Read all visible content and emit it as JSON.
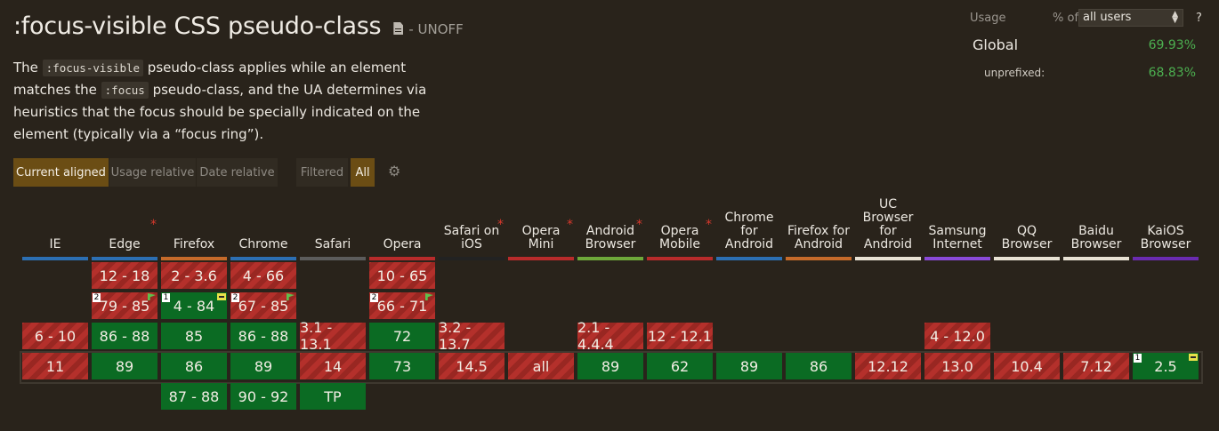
{
  "title": ":focus-visible CSS pseudo-class",
  "status": "- UNOFF",
  "description": {
    "p1": "The ",
    "code1": ":focus-visible",
    "p2": " pseudo-class applies while an element matches the ",
    "code2": ":focus",
    "p3": " pseudo-class, and the UA determines via heuristics that the focus should be specially indicated on the element (typically via a “focus ring”)."
  },
  "view_buttons": [
    "Current aligned",
    "Usage relative",
    "Date relative"
  ],
  "filter_buttons": [
    "Filtered",
    "All"
  ],
  "usage": {
    "label": "Usage",
    "pct_of": "% of",
    "selected": "all users",
    "help": "?",
    "global_label": "Global",
    "global_value": "69.93%",
    "unprefixed_label": "unprefixed:",
    "unprefixed_value": "68.83%"
  },
  "colors": {
    "supported": "#0b6b23",
    "unsupported": "#b4302b",
    "background": "#29231b",
    "active_button": "#6b4d14"
  },
  "browsers": [
    {
      "name": "IE",
      "star": false,
      "color": "#2c6fb3"
    },
    {
      "name": "Edge",
      "star": true,
      "color": "#2c6fb3"
    },
    {
      "name": "Firefox",
      "star": false,
      "color": "#c56a2a"
    },
    {
      "name": "Chrome",
      "star": false,
      "color": "#2c6fb3"
    },
    {
      "name": "Safari",
      "star": false,
      "color": "#5c5c5c"
    },
    {
      "name": "Opera",
      "star": false,
      "color": "#b82b2b"
    },
    {
      "name": "Safari on iOS",
      "star": true,
      "color": "#222222"
    },
    {
      "name": "Opera Mini",
      "star": true,
      "color": "#b82b2b"
    },
    {
      "name": "Android Browser",
      "star": true,
      "color": "#6ea83a"
    },
    {
      "name": "Opera Mobile",
      "star": true,
      "color": "#b82b2b"
    },
    {
      "name": "Chrome for Android",
      "star": false,
      "color": "#2c6fb3"
    },
    {
      "name": "Firefox for Android",
      "star": false,
      "color": "#c56a2a"
    },
    {
      "name": "UC Browser for Android",
      "star": false,
      "color": "#e8e2d4"
    },
    {
      "name": "Samsung Internet",
      "star": false,
      "color": "#8a4ad8"
    },
    {
      "name": "QQ Browser",
      "star": false,
      "color": "#e8e2d4"
    },
    {
      "name": "Baidu Browser",
      "star": false,
      "color": "#e8e2d4"
    },
    {
      "name": "KaiOS Browser",
      "star": false,
      "color": "#6a2bb0"
    }
  ],
  "cells": [
    {
      "col": 1,
      "row": 0,
      "text": "12 - 18",
      "s": "n"
    },
    {
      "col": 2,
      "row": 0,
      "text": "2 - 3.6",
      "s": "n"
    },
    {
      "col": 3,
      "row": 0,
      "text": "4 - 66",
      "s": "n"
    },
    {
      "col": 5,
      "row": 0,
      "text": "10 - 65",
      "s": "n"
    },
    {
      "col": 1,
      "row": 1,
      "text": "79 - 85",
      "s": "n",
      "note": "2",
      "mark": "flag"
    },
    {
      "col": 2,
      "row": 1,
      "text": "4 - 84",
      "s": "y",
      "note": "1",
      "mark": "minus"
    },
    {
      "col": 3,
      "row": 1,
      "text": "67 - 85",
      "s": "n",
      "note": "2",
      "mark": "flag"
    },
    {
      "col": 5,
      "row": 1,
      "text": "66 - 71",
      "s": "n",
      "note": "2",
      "mark": "flag"
    },
    {
      "col": 0,
      "row": 2,
      "text": "6 - 10",
      "s": "n"
    },
    {
      "col": 1,
      "row": 2,
      "text": "86 - 88",
      "s": "y"
    },
    {
      "col": 2,
      "row": 2,
      "text": "85",
      "s": "y"
    },
    {
      "col": 3,
      "row": 2,
      "text": "86 - 88",
      "s": "y"
    },
    {
      "col": 4,
      "row": 2,
      "text": "3.1 - 13.1",
      "s": "n"
    },
    {
      "col": 5,
      "row": 2,
      "text": "72",
      "s": "y"
    },
    {
      "col": 6,
      "row": 2,
      "text": "3.2 - 13.7",
      "s": "n"
    },
    {
      "col": 8,
      "row": 2,
      "text": "2.1 - 4.4.4",
      "s": "n"
    },
    {
      "col": 9,
      "row": 2,
      "text": "12 - 12.1",
      "s": "n"
    },
    {
      "col": 13,
      "row": 2,
      "text": "4 - 12.0",
      "s": "n"
    },
    {
      "col": 0,
      "row": 3,
      "text": "11",
      "s": "n"
    },
    {
      "col": 1,
      "row": 3,
      "text": "89",
      "s": "y"
    },
    {
      "col": 2,
      "row": 3,
      "text": "86",
      "s": "y"
    },
    {
      "col": 3,
      "row": 3,
      "text": "89",
      "s": "y"
    },
    {
      "col": 4,
      "row": 3,
      "text": "14",
      "s": "n"
    },
    {
      "col": 5,
      "row": 3,
      "text": "73",
      "s": "y"
    },
    {
      "col": 6,
      "row": 3,
      "text": "14.5",
      "s": "n"
    },
    {
      "col": 7,
      "row": 3,
      "text": "all",
      "s": "n"
    },
    {
      "col": 8,
      "row": 3,
      "text": "89",
      "s": "y"
    },
    {
      "col": 9,
      "row": 3,
      "text": "62",
      "s": "y"
    },
    {
      "col": 10,
      "row": 3,
      "text": "89",
      "s": "y"
    },
    {
      "col": 11,
      "row": 3,
      "text": "86",
      "s": "y"
    },
    {
      "col": 12,
      "row": 3,
      "text": "12.12",
      "s": "n"
    },
    {
      "col": 13,
      "row": 3,
      "text": "13.0",
      "s": "n"
    },
    {
      "col": 14,
      "row": 3,
      "text": "10.4",
      "s": "n"
    },
    {
      "col": 15,
      "row": 3,
      "text": "7.12",
      "s": "n"
    },
    {
      "col": 16,
      "row": 3,
      "text": "2.5",
      "s": "y",
      "note": "1",
      "mark": "minus"
    },
    {
      "col": 2,
      "row": 4,
      "text": "87 - 88",
      "s": "y"
    },
    {
      "col": 3,
      "row": 4,
      "text": "90 - 92",
      "s": "y"
    },
    {
      "col": 4,
      "row": 4,
      "text": "TP",
      "s": "y"
    }
  ]
}
